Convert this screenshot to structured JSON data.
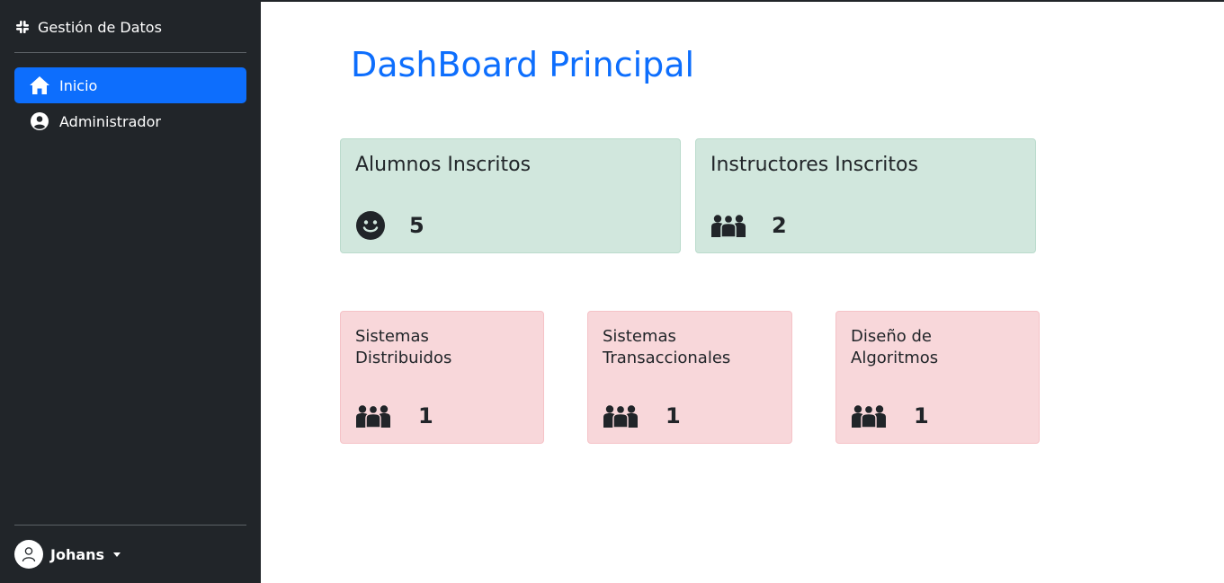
{
  "sidebar": {
    "brand": "Gestión de Datos",
    "items": [
      {
        "label": "Inicio",
        "icon": "home-icon",
        "active": true
      },
      {
        "label": "Administrador",
        "icon": "user-circle-icon",
        "active": false
      }
    ],
    "user": {
      "name": "Johans"
    }
  },
  "main": {
    "title": "DashBoard Principal",
    "summary_cards": [
      {
        "title": "Alumnos Inscritos",
        "icon": "smile-icon",
        "count": "5"
      },
      {
        "title": "Instructores Inscritos",
        "icon": "group-icon",
        "count": "2"
      }
    ],
    "course_cards": [
      {
        "title": "Sistemas Distribuidos",
        "icon": "group-icon",
        "count": "1"
      },
      {
        "title": "Sistemas Transaccionales",
        "icon": "group-icon",
        "count": "1"
      },
      {
        "title": "Diseño de Algoritmos",
        "icon": "group-icon",
        "count": "1"
      }
    ]
  },
  "colors": {
    "accent": "#0d6efd",
    "sidebar_bg": "#212529",
    "summary_card_bg": "#d1e7dd",
    "course_card_bg": "#f8d7da"
  }
}
